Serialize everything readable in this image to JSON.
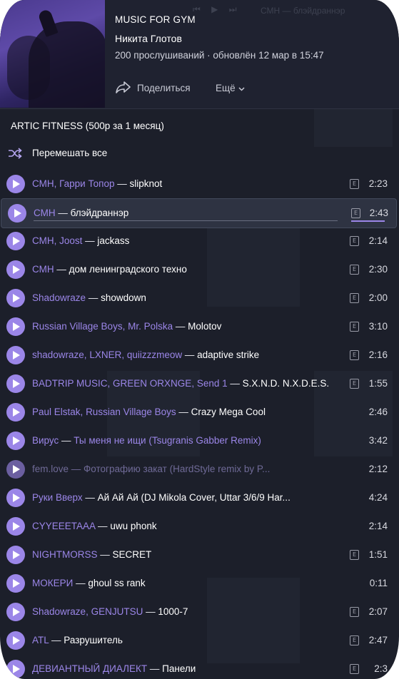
{
  "header": {
    "playlist_title": "MUSIC FOR GYM",
    "author": "Никита Глотов",
    "stats": "200 прослушиваний · обновлён 12 мар в 15:47",
    "share_label": "Поделиться",
    "more_label": "Ещё",
    "bg_title": "СМН — блэйдраннэр"
  },
  "section": {
    "label": "ARTIC FITNESS (500р за 1 месяц)"
  },
  "shuffle": {
    "label": "Перемешать все"
  },
  "tracks": [
    {
      "artists": [
        "СМН",
        "Гарри Топор"
      ],
      "title": "slipknot",
      "explicit": true,
      "duration": "2:23"
    },
    {
      "artists": [
        "СМН"
      ],
      "title": "блэйдраннэр",
      "explicit": true,
      "duration": "2:43",
      "active": true,
      "playback_progress": 1.0
    },
    {
      "artists": [
        "СМН",
        "Joost"
      ],
      "title": "jackass",
      "explicit": true,
      "duration": "2:14"
    },
    {
      "artists": [
        "СМН"
      ],
      "title": "дом ленинградского техно",
      "explicit": true,
      "duration": "2:30"
    },
    {
      "artists": [
        "Shadowraze"
      ],
      "title": "showdown",
      "explicit": true,
      "duration": "2:00"
    },
    {
      "artists": [
        "Russian Village Boys",
        "Mr. Polska"
      ],
      "title": "Molotov",
      "explicit": true,
      "duration": "3:10"
    },
    {
      "artists": [
        "shadowraze",
        "LXNER",
        "quiizzzmeow"
      ],
      "title": "adaptive strike",
      "explicit": true,
      "duration": "2:16"
    },
    {
      "artists": [
        "BADTRIP MUSIC",
        "GREEN ORXNGE",
        "Send 1"
      ],
      "title": "S.X.N.D. N.X.D.E.S.",
      "explicit": true,
      "duration": "1:55"
    },
    {
      "artists": [
        "Paul Elstak",
        "Russian Village Boys"
      ],
      "title": "Crazy Mega Cool",
      "explicit": false,
      "duration": "2:46"
    },
    {
      "artists": [
        "Вирус"
      ],
      "title": "Ты меня не ищи (Tsugranis Gabber Remix)",
      "explicit": false,
      "duration": "3:42",
      "title_muted": true
    },
    {
      "artists": [
        "fem.love"
      ],
      "title": "Фотографию закат (HardStyle remix by P...",
      "explicit": false,
      "duration": "2:12",
      "dimmed": true
    },
    {
      "artists": [
        "Руки Вверх"
      ],
      "title": "Ай Ай Ай (DJ Mikola Cover, Uttar 3/6/9 Har...",
      "explicit": false,
      "duration": "4:24"
    },
    {
      "artists": [
        "CYYEEETAAA"
      ],
      "title": "uwu phonk",
      "explicit": false,
      "duration": "2:14"
    },
    {
      "artists": [
        "NIGHTMORSS"
      ],
      "title": "SECRET",
      "explicit": true,
      "duration": "1:51"
    },
    {
      "artists": [
        "МОКЕРИ"
      ],
      "title": "ghoul ss rank",
      "explicit": false,
      "duration": "0:11"
    },
    {
      "artists": [
        "Shadowraze",
        "GENJUTSU"
      ],
      "title": "1000-7",
      "explicit": true,
      "duration": "2:07"
    },
    {
      "artists": [
        "ATL"
      ],
      "title": "Разрушитель",
      "explicit": true,
      "duration": "2:47"
    },
    {
      "artists": [
        "ДЕВИАНТНЫЙ ДИАЛЕКТ"
      ],
      "title": "Панели",
      "explicit": true,
      "duration": "2:3"
    }
  ],
  "colors": {
    "accent": "#9b86e8",
    "background": "#1c1f2a",
    "active_row": "#2e3342"
  },
  "icons": {
    "share": "share-arrow-icon",
    "more": "chevron-down-icon",
    "shuffle": "shuffle-icon",
    "play": "play-icon",
    "explicit": "explicit-badge-icon"
  }
}
